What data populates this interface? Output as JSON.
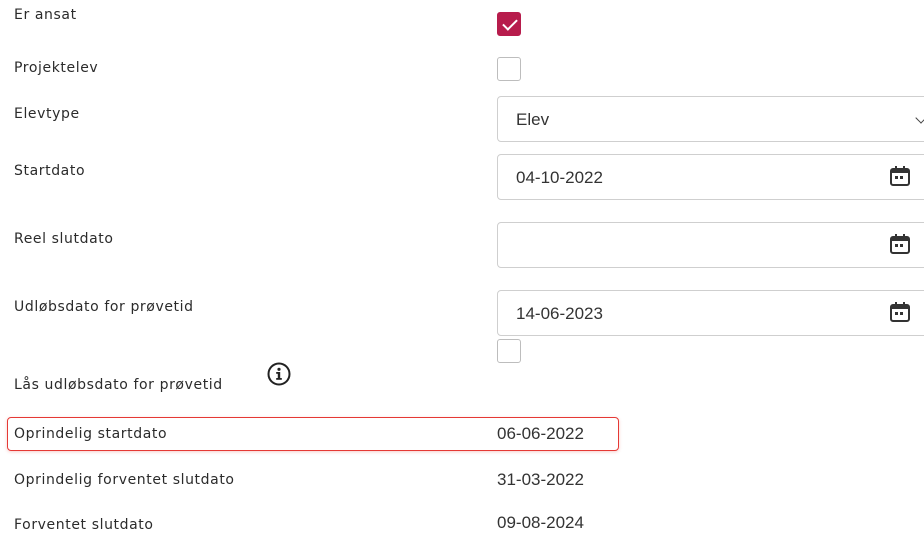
{
  "fields": {
    "er_ansat": {
      "label": "Er ansat",
      "checked": true
    },
    "projektelev": {
      "label": "Projektelev",
      "checked": false
    },
    "elevtype": {
      "label": "Elevtype",
      "value": "Elev"
    },
    "startdato": {
      "label": "Startdato",
      "value": "04-10-2022"
    },
    "reel_slutdato": {
      "label": "Reel slutdato",
      "value": ""
    },
    "udlobsdato": {
      "label": "Udløbsdato for prøvetid",
      "value": "14-06-2023"
    },
    "laas_udlobsdato": {
      "label": "Lås udløbsdato for prøvetid",
      "checked": false
    },
    "oprindelig_startdato": {
      "label": "Oprindelig startdato",
      "value": "06-06-2022"
    },
    "oprindelig_forventet_slutdato": {
      "label": "Oprindelig forventet slutdato",
      "value": "31-03-2022"
    },
    "forventet_slutdato": {
      "label": "Forventet slutdato",
      "value": "09-08-2024"
    }
  },
  "colors": {
    "checkbox_checked": "#b71c4c",
    "highlight_border": "#e53935"
  },
  "icons": {
    "calendar": "calendar-icon",
    "info": "info-icon",
    "dropdown": "chevron-down-icon"
  }
}
